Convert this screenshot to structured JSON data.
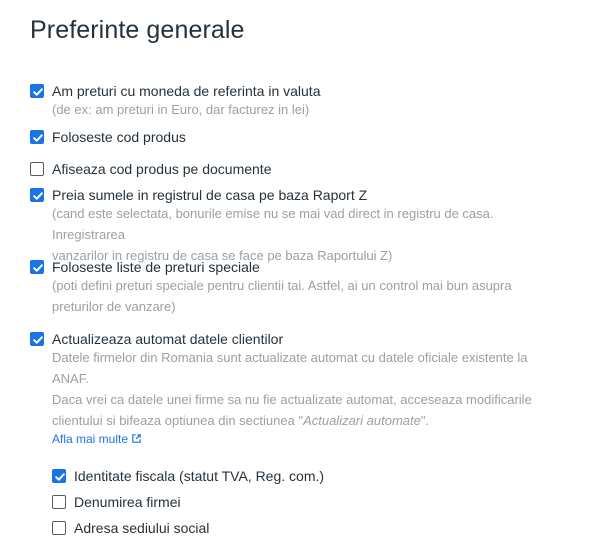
{
  "title": "Preferinte generale",
  "options": [
    {
      "label": "Am preturi cu moneda de referinta in valuta",
      "checked": true
    },
    {
      "label": "Foloseste cod produs",
      "checked": true
    },
    {
      "label": "Afiseaza cod produs pe documente",
      "checked": false
    },
    {
      "label": "Preia sumele in registrul de casa pe baza Raport Z",
      "checked": true
    },
    {
      "label": "Foloseste liste de preturi speciale",
      "checked": true
    },
    {
      "label": "Actualizeaza automat datele clientilor",
      "checked": true
    }
  ],
  "hints": {
    "currency": "(de ex: am preturi in Euro, dar facturez in lei)",
    "raport_z_line1": "(cand este selectata, bonurile emise nu se mai vad direct in registru de casa. Inregistrarea",
    "raport_z_line2": "vanzarilor in registru de casa se face pe baza Raportului Z)",
    "price_lists_line1": "(poti defini preturi speciale pentru clientii tai. Astfel, ai un control mai bun asupra",
    "price_lists_line2": "preturilor de vanzare)",
    "anaf_line1": "Datele firmelor din Romania sunt actualizate automat cu datele oficiale existente la",
    "anaf_line2": "ANAF.",
    "anaf_line3": "Daca vrei ca datele unei firme sa nu fie actualizate automat, acceseaza modificarile",
    "anaf_line4_prefix": "clientului si bifeaza optiunea din sectiunea \"",
    "anaf_line4_em": "Actualizari automate",
    "anaf_line4_suffix": "\"."
  },
  "learn_more": "Afla mai multe",
  "sub_options": [
    {
      "label": "Identitate fiscala (statut TVA, Reg. com.)",
      "checked": true
    },
    {
      "label": "Denumirea firmei",
      "checked": false
    },
    {
      "label": "Adresa sediului social",
      "checked": false
    }
  ],
  "colors": {
    "accent": "#1a73e8",
    "hint": "#9aa0a6",
    "text": "#26323b"
  }
}
